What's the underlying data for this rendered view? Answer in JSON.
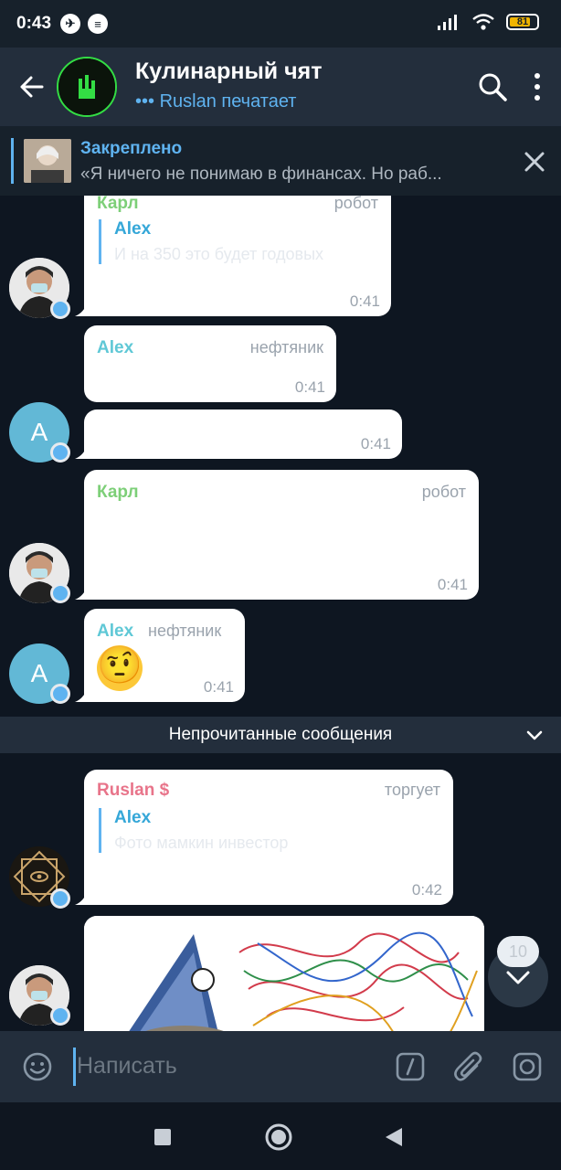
{
  "status_bar": {
    "time": "0:43",
    "battery": "81"
  },
  "header": {
    "title": "Кулинарный чят",
    "status": "••• Ruslan печатает"
  },
  "pinned": {
    "title": "Закреплено",
    "text": "«Я ничего не понимаю в финансах. Но раб..."
  },
  "messages": [
    {
      "name": "Карл",
      "role": "робот",
      "quote_name": "Alex",
      "quote_text": "И на 350 это будет годовых",
      "time": "0:41"
    },
    {
      "name": "Alex",
      "role": "нефтяник",
      "time": "0:41"
    },
    {
      "time": "0:41"
    },
    {
      "name": "Карл",
      "role": "робот",
      "time": "0:41"
    },
    {
      "name": "Alex",
      "role": "нефтяник",
      "emoji": "🤨",
      "time": "0:41"
    },
    {
      "name": "Ruslan $",
      "role": "торгует",
      "quote_name": "Alex",
      "quote_text": "Фото мамкин инвестор",
      "time": "0:42"
    }
  ],
  "avatar_letter": "A",
  "unread_divider": "Непрочитанные сообщения",
  "scroll_badge": "10",
  "input": {
    "placeholder": "Написать"
  },
  "colors": {
    "accent": "#5fb3f0",
    "karl_name": "#7dcf78",
    "alex_name": "#5fc8d6",
    "ruslan_name": "#e8748a"
  },
  "icons": [
    "back-arrow-icon",
    "search-icon",
    "more-vert-icon",
    "close-icon",
    "chevron-down-icon",
    "emoji-icon",
    "bot-command-icon",
    "attach-icon",
    "camera-icon",
    "nav-stop-icon",
    "nav-home-icon",
    "nav-back-icon"
  ]
}
